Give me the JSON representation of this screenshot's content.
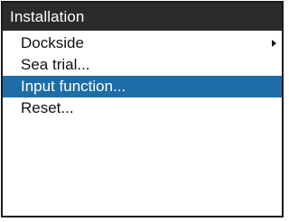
{
  "window": {
    "title": "Installation"
  },
  "menu": {
    "items": [
      {
        "label": "Dockside",
        "has_submenu": true,
        "selected": false
      },
      {
        "label": "Sea trial...",
        "has_submenu": false,
        "selected": false
      },
      {
        "label": "Input function...",
        "has_submenu": false,
        "selected": true
      },
      {
        "label": "Reset...",
        "has_submenu": false,
        "selected": false
      }
    ]
  },
  "colors": {
    "title_bar": "#2b2b2b",
    "selection": "#1f6da6"
  },
  "icons": {
    "submenu": "chevron-right-icon"
  }
}
